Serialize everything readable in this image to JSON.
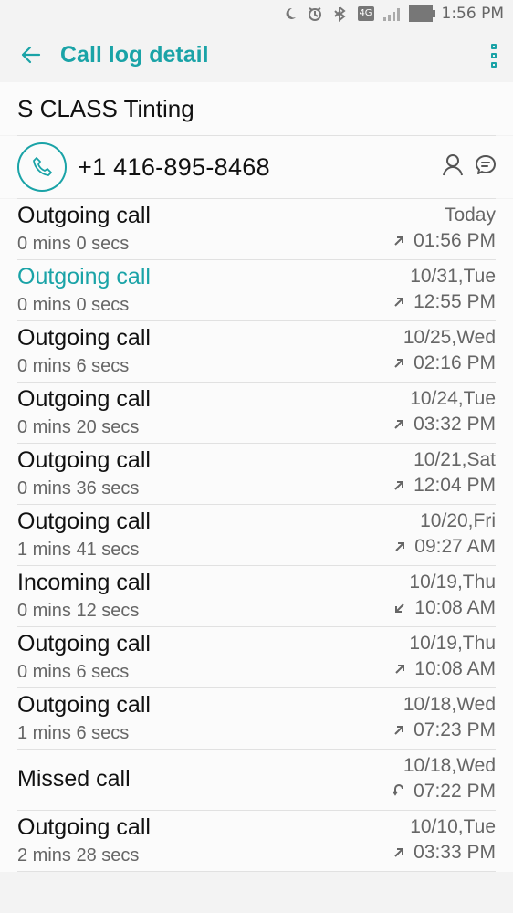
{
  "status_bar": {
    "time": "1:56 PM",
    "lte": "4G"
  },
  "header": {
    "title": "Call log detail"
  },
  "contact": {
    "name": "S CLASS Tinting",
    "phone": "+1 416-895-8468"
  },
  "colors": {
    "accent": "#1aa3a7",
    "text": "#111111",
    "secondary": "#666666",
    "divider": "#e1e1e1"
  },
  "logs": [
    {
      "type": "Outgoing call",
      "duration": "0 mins 0 secs",
      "date": "Today",
      "time": "01:56 PM",
      "direction": "outgoing"
    },
    {
      "type": "Outgoing call",
      "duration": "0 mins 0 secs",
      "date": "10/31,Tue",
      "time": "12:55 PM",
      "direction": "outgoing"
    },
    {
      "type": "Outgoing call",
      "duration": "0 mins 6 secs",
      "date": "10/25,Wed",
      "time": "02:16 PM",
      "direction": "outgoing"
    },
    {
      "type": "Outgoing call",
      "duration": "0 mins 20 secs",
      "date": "10/24,Tue",
      "time": "03:32 PM",
      "direction": "outgoing"
    },
    {
      "type": "Outgoing call",
      "duration": "0 mins 36 secs",
      "date": "10/21,Sat",
      "time": "12:04 PM",
      "direction": "outgoing"
    },
    {
      "type": "Outgoing call",
      "duration": "1 mins 41 secs",
      "date": "10/20,Fri",
      "time": "09:27 AM",
      "direction": "outgoing"
    },
    {
      "type": "Incoming call",
      "duration": "0 mins 12 secs",
      "date": "10/19,Thu",
      "time": "10:08 AM",
      "direction": "incoming"
    },
    {
      "type": "Outgoing call",
      "duration": "0 mins 6 secs",
      "date": "10/19,Thu",
      "time": "10:08 AM",
      "direction": "outgoing"
    },
    {
      "type": "Outgoing call",
      "duration": "1 mins 6 secs",
      "date": "10/18,Wed",
      "time": "07:23 PM",
      "direction": "outgoing"
    },
    {
      "type": "Missed call",
      "duration": "",
      "date": "10/18,Wed",
      "time": "07:22 PM",
      "direction": "missed"
    },
    {
      "type": "Outgoing call",
      "duration": "2 mins 28 secs",
      "date": "10/10,Tue",
      "time": "03:33 PM",
      "direction": "outgoing"
    }
  ]
}
